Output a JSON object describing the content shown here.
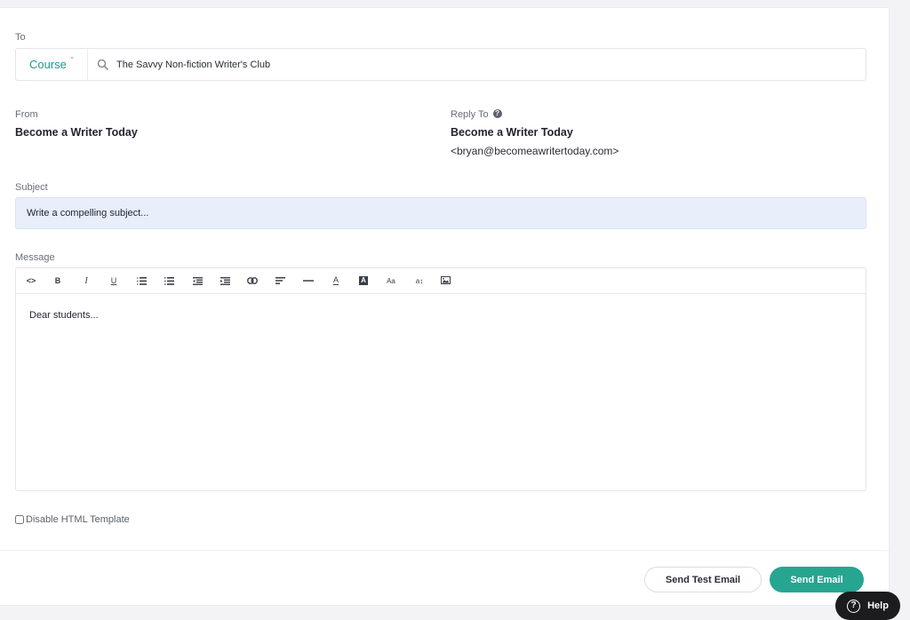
{
  "to": {
    "label": "To",
    "recipient_type": "Course",
    "search_value": "The Savvy Non-fiction Writer's Club"
  },
  "from": {
    "label": "From",
    "name": "Become a Writer Today"
  },
  "reply_to": {
    "label": "Reply To",
    "help_icon": "?",
    "name": "Become a Writer Today",
    "email": "<bryan@becomeawritertoday.com>"
  },
  "subject": {
    "label": "Subject",
    "placeholder": "Write a compelling subject...",
    "value": ""
  },
  "message": {
    "label": "Message",
    "toolbar": [
      {
        "name": "code-view",
        "icon": "code-icon",
        "glyph": "<>"
      },
      {
        "name": "bold",
        "icon": "bold-icon",
        "glyph": "B"
      },
      {
        "name": "italic",
        "icon": "italic-icon",
        "glyph": "I"
      },
      {
        "name": "underline",
        "icon": "underline-icon",
        "glyph": "U"
      },
      {
        "name": "ordered-list",
        "icon": "ordered-list-icon",
        "glyph": ""
      },
      {
        "name": "unordered-list",
        "icon": "unordered-list-icon",
        "glyph": ""
      },
      {
        "name": "outdent",
        "icon": "outdent-icon",
        "glyph": ""
      },
      {
        "name": "indent",
        "icon": "indent-icon",
        "glyph": ""
      },
      {
        "name": "link",
        "icon": "link-icon",
        "glyph": ""
      },
      {
        "name": "align",
        "icon": "align-left-icon",
        "glyph": ""
      },
      {
        "name": "horizontal-rule",
        "icon": "horizontal-rule-icon",
        "glyph": ""
      },
      {
        "name": "font-color",
        "icon": "font-color-icon",
        "glyph": "A"
      },
      {
        "name": "background-color",
        "icon": "background-color-icon",
        "glyph": "A"
      },
      {
        "name": "font-size",
        "icon": "font-size-icon",
        "glyph": "Aa"
      },
      {
        "name": "line-height",
        "icon": "line-height-icon",
        "glyph": "a↕"
      },
      {
        "name": "insert-image",
        "icon": "image-icon",
        "glyph": ""
      }
    ],
    "body": "Dear students..."
  },
  "options": {
    "disable_html_template_label": "Disable HTML Template",
    "disable_html_template_checked": false
  },
  "actions": {
    "send_test_label": "Send Test Email",
    "send_label": "Send Email"
  },
  "help": {
    "label": "Help"
  },
  "colors": {
    "accent": "#26a591",
    "course_text": "#1f9a88",
    "subject_bg": "#e8effb",
    "help_bg": "#1c1c1e",
    "page_bg": "#f3f3f6"
  }
}
